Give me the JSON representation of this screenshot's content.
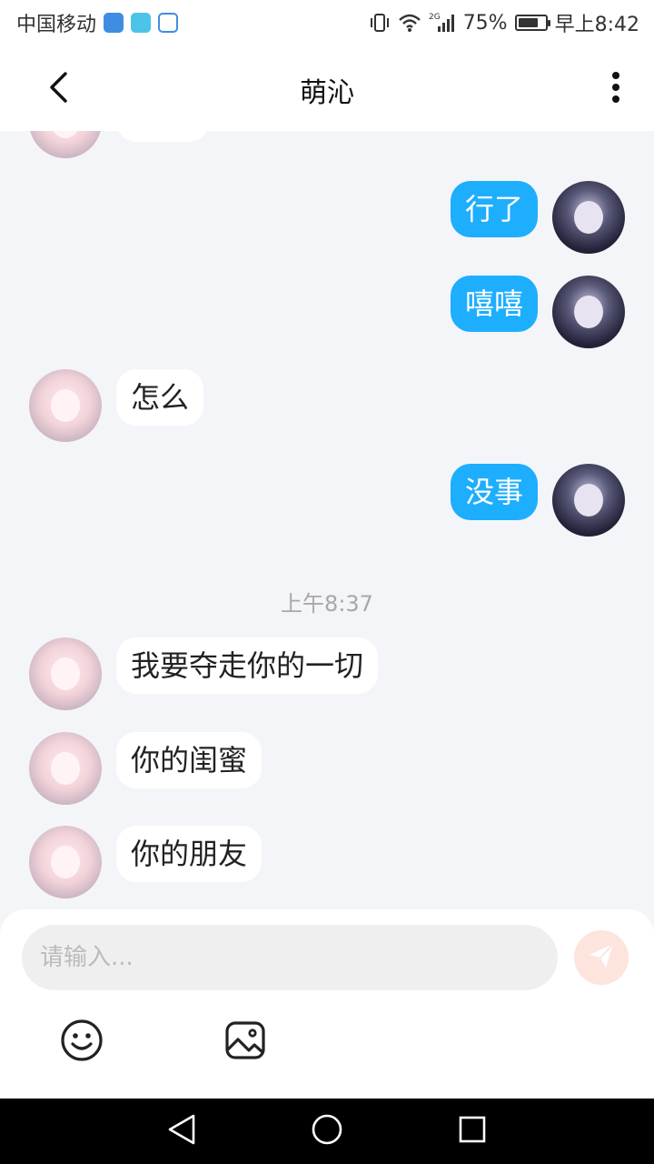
{
  "status_bar": {
    "carrier": "中国移动",
    "network_badge": "2G",
    "battery": "75%",
    "battery_level": 0.75,
    "time": "早上8:42",
    "icons": [
      "shield-app-icon",
      "book-app-icon",
      "paw-app-icon",
      "vibrate-icon",
      "wifi-icon",
      "signal-icon",
      "battery-icon"
    ]
  },
  "header": {
    "title": "萌沁",
    "back_icon": "chevron-left-icon",
    "more_icon": "more-vertical-icon"
  },
  "messages": [
    {
      "side": "out",
      "text": "行了"
    },
    {
      "side": "out",
      "text": "嘻嘻"
    },
    {
      "side": "in",
      "text": "怎么"
    },
    {
      "side": "out",
      "text": "没事"
    },
    {
      "timestamp": "上午8:37"
    },
    {
      "side": "in",
      "text": "我要夺走你的一切"
    },
    {
      "side": "in",
      "text": "你的闺蜜"
    },
    {
      "side": "in",
      "text": "你的朋友"
    }
  ],
  "composer": {
    "placeholder": "请输入...",
    "send_icon": "paper-plane-icon",
    "emoji_icon": "smiley-icon",
    "image_icon": "image-icon"
  },
  "colors": {
    "outgoing_bubble": "#1eaefe",
    "incoming_bubble": "#ffffff",
    "chat_background": "#f4f5f8",
    "send_button": "#fde4dc"
  },
  "nav_bar": {
    "icons": [
      "back-triangle-icon",
      "home-circle-icon",
      "recents-square-icon"
    ]
  }
}
